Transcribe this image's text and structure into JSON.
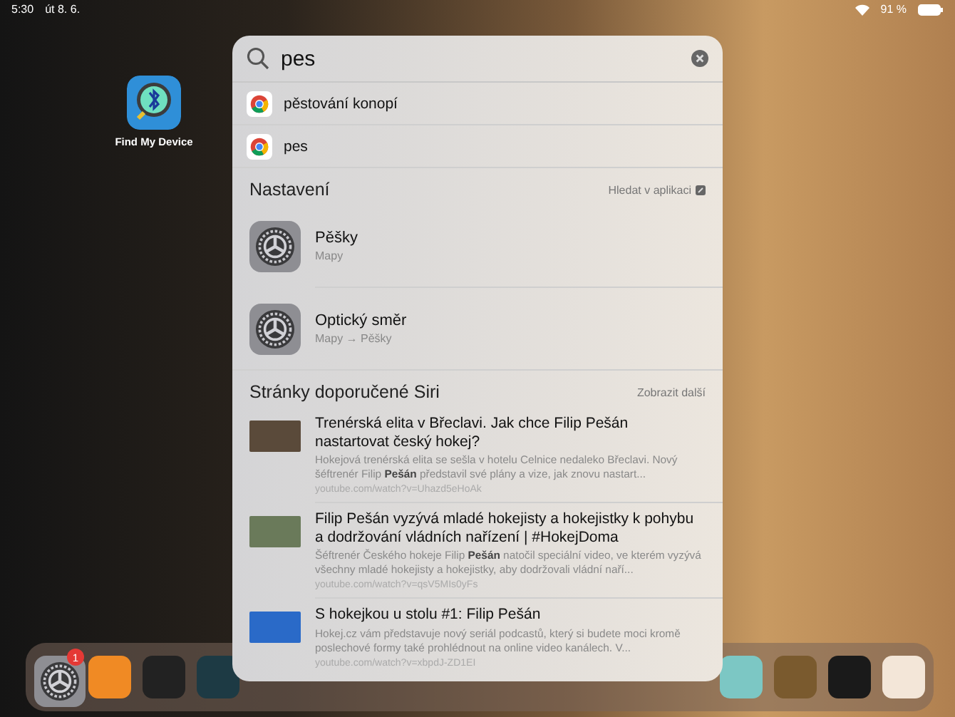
{
  "status_bar": {
    "time": "5:30",
    "date": "út 8. 6.",
    "battery": "91 %"
  },
  "home_apps": [
    {
      "label": "Find My Device"
    }
  ],
  "search": {
    "value": "pes"
  },
  "suggestions": [
    {
      "text": "pěstování konopí"
    },
    {
      "text": "pes"
    }
  ],
  "settings_section": {
    "title": "Nastavení",
    "action": "Hledat v aplikaci",
    "items": [
      {
        "title": "Pěšky",
        "path": "Mapy"
      },
      {
        "title": "Optický směr",
        "path": "Mapy → Pěšky"
      }
    ]
  },
  "siri_section": {
    "title": "Stránky doporučené Siri",
    "action": "Zobrazit další",
    "results": [
      {
        "title": "Trenérská elita v Břeclavi. Jak chce Filip Pešán nastartovat český hokej?",
        "snippet": "Hokejová trenérská elita se sešla v hotelu Celnice nedaleko Břeclavi. Nový šéftrenér Filip **Pešán** představil své plány a vize, jak znovu nastart...",
        "url": "youtube.com/watch?v=Uhazd5eHoAk"
      },
      {
        "title": "Filip Pešán vyzývá mladé hokejisty a hokejistky k pohybu a dodržování vládních nařízení | #HokejDoma",
        "snippet": "Šéftrenér Českého hokeje Filip **Pešán** natočil speciální video, ve kterém vyzývá všechny mladé hokejisty a hokejistky, aby dodržovali vládní naří...",
        "url": "youtube.com/watch?v=qsV5MIs0yFs"
      },
      {
        "title": "S hokejkou u stolu #1: Filip Pešán",
        "snippet": "Hokej.cz vám představuje nový seriál podcastů, který si budete moci kromě poslechové formy také prohlédnout na online video kanálech. V...",
        "url": "youtube.com/watch?v=xbpdJ-ZD1EI"
      }
    ]
  },
  "dock": {
    "left": [
      {
        "kind": "settings",
        "badge": "1"
      },
      {
        "kind": "books"
      },
      {
        "kind": "draw"
      },
      {
        "kind": "pen"
      }
    ],
    "right": [
      {
        "kind": "game"
      },
      {
        "kind": "blocks"
      },
      {
        "kind": "translate"
      },
      {
        "kind": "folder"
      }
    ]
  }
}
